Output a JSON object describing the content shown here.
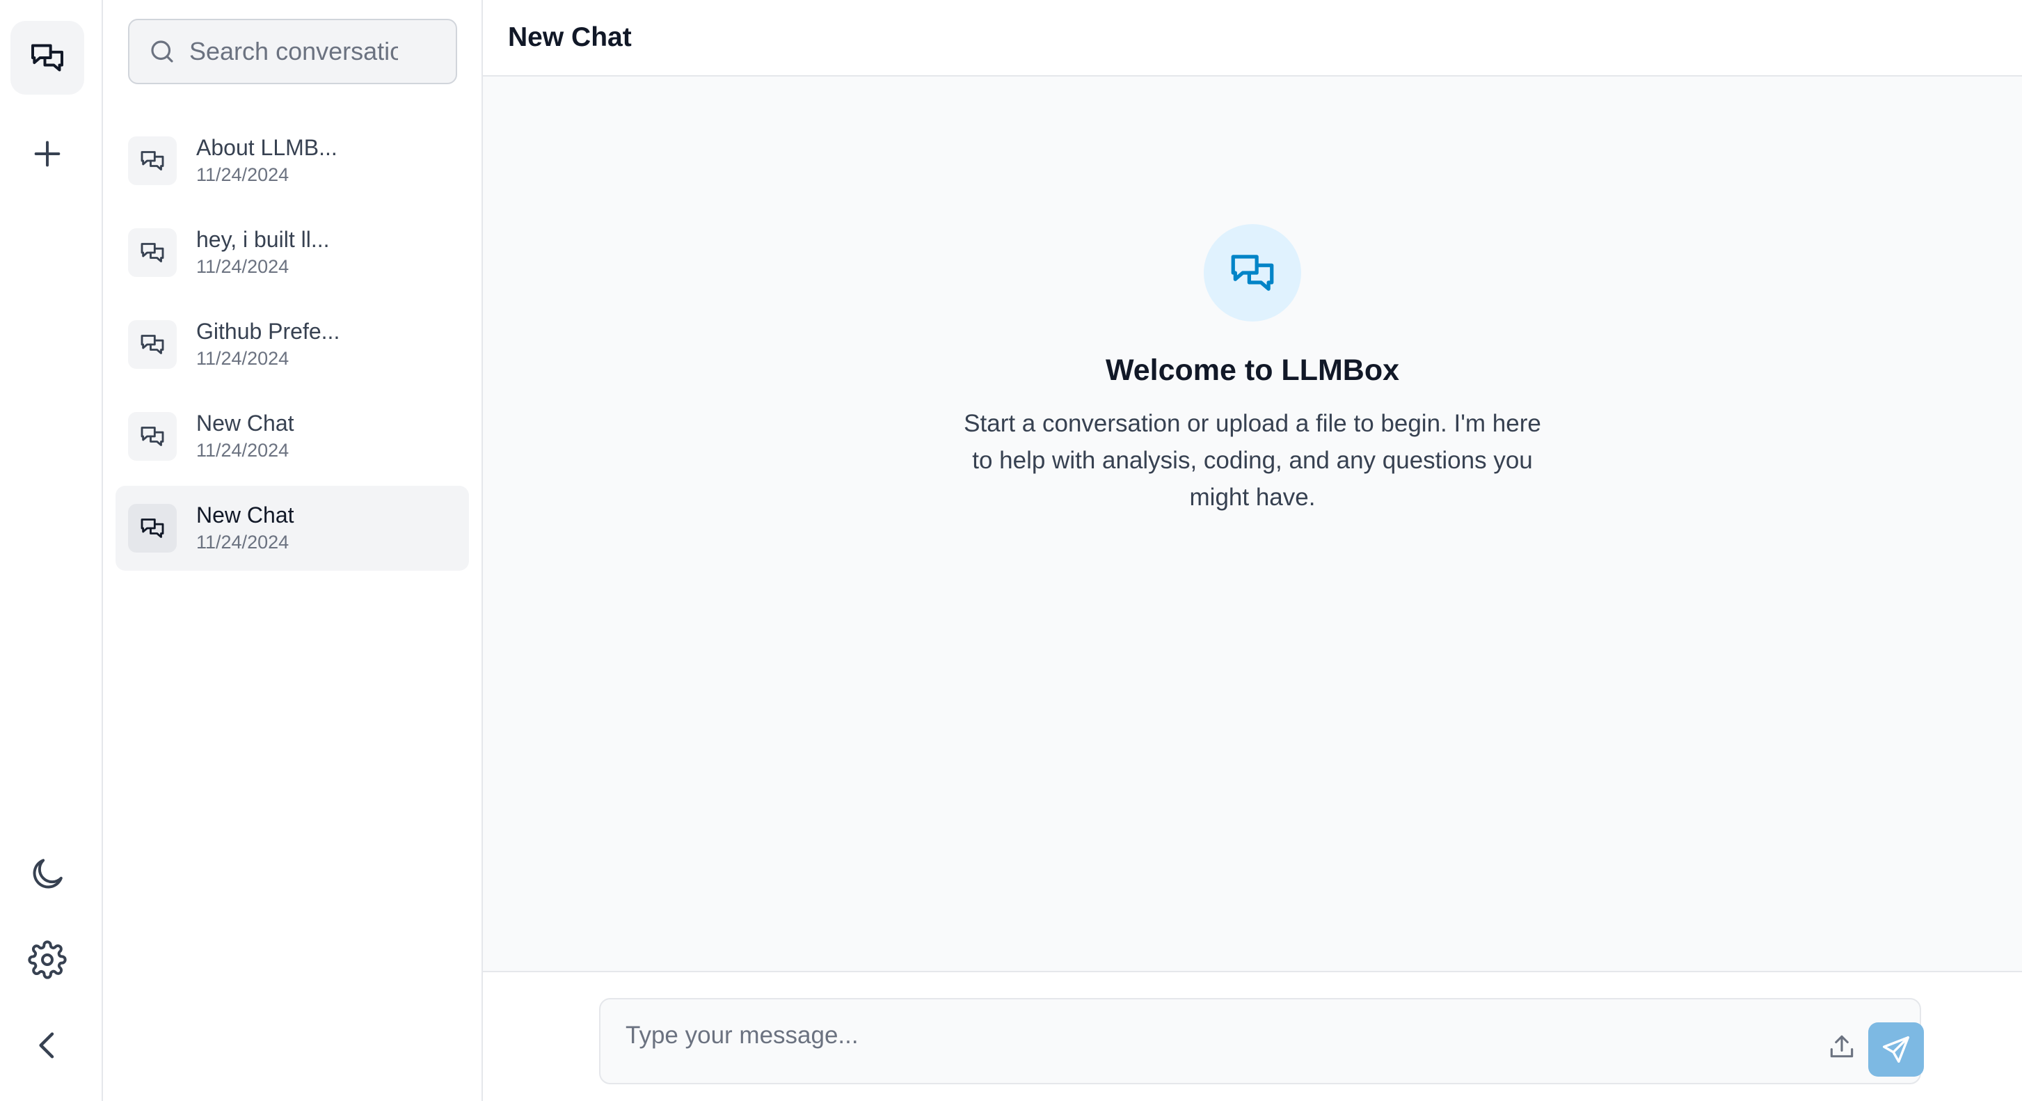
{
  "rail": {
    "items": [
      {
        "icon": "chats-icon",
        "active": true
      },
      {
        "icon": "plus-icon"
      },
      {
        "icon": "moon-icon"
      },
      {
        "icon": "gear-icon"
      },
      {
        "icon": "chevron-left-icon"
      }
    ]
  },
  "sidebar": {
    "search": {
      "placeholder": "Search conversations",
      "value": ""
    },
    "conversations": [
      {
        "title": "About LLMB...",
        "date": "11/24/2024"
      },
      {
        "title": "hey, i built ll...",
        "date": "11/24/2024"
      },
      {
        "title": "Github Prefe...",
        "date": "11/24/2024"
      },
      {
        "title": "New Chat",
        "date": "11/24/2024"
      },
      {
        "title": "New Chat",
        "date": "11/24/2024",
        "active": true
      }
    ]
  },
  "header": {
    "title": "New Chat"
  },
  "welcome": {
    "icon": "chats-icon",
    "title": "Welcome to LLMBox",
    "text": "Start a conversation or upload a file to begin. I'm here to help with analysis, coding, and any questions you might have."
  },
  "composer": {
    "placeholder": "Type your message...",
    "value": "",
    "upload_icon": "upload-icon",
    "send_icon": "send-icon"
  },
  "colors": {
    "accent": "#0284c7",
    "accent_soft": "#e0f2fe",
    "send_button": "#7db9e3",
    "border": "#e5e7eb",
    "active_bg": "#f3f4f6"
  }
}
